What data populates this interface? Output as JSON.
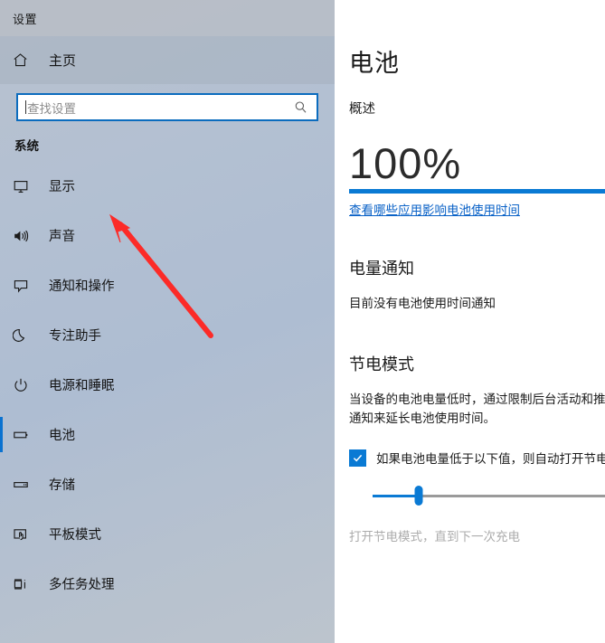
{
  "window": {
    "title": "设置"
  },
  "sidebar": {
    "home": {
      "label": "主页",
      "icon": "home-icon"
    },
    "search": {
      "placeholder": "查找设置",
      "value": "",
      "icon": "search-icon"
    },
    "section_title": "系统",
    "items": [
      {
        "label": "显示",
        "icon": "monitor-icon",
        "selected": false
      },
      {
        "label": "声音",
        "icon": "speaker-icon",
        "selected": false
      },
      {
        "label": "通知和操作",
        "icon": "notification-bubble-icon",
        "selected": false
      },
      {
        "label": "专注助手",
        "icon": "moon-icon",
        "selected": false
      },
      {
        "label": "电源和睡眠",
        "icon": "power-icon",
        "selected": false
      },
      {
        "label": "电池",
        "icon": "battery-icon",
        "selected": true
      },
      {
        "label": "存储",
        "icon": "storage-icon",
        "selected": false
      },
      {
        "label": "平板模式",
        "icon": "tablet-mode-icon",
        "selected": false
      },
      {
        "label": "多任务处理",
        "icon": "multitasking-icon",
        "selected": false
      }
    ]
  },
  "content": {
    "page_title": "电池",
    "overview_heading": "概述",
    "battery_percent": "100%",
    "battery_level": 100,
    "battery_link": "查看哪些应用影响电池使用时间",
    "notifications_heading": "电量通知",
    "notifications_text": "目前没有电池使用时间通知",
    "battery_saver_heading": "节电模式",
    "battery_saver_description": "当设备的电池电量低时，通过限制后台活动和推送通知来延长电池使用时间。",
    "checkbox_label": "如果电池电量低于以下值，则自动打开节电模式：",
    "checkbox_checked": true,
    "checkbox_glyph": "✓",
    "slider_value": 20,
    "slider_disabled_note": "打开节电模式，直到下一次充电"
  },
  "annotation": {
    "type": "arrow",
    "color": "#fc2b28",
    "points_to": "显示"
  },
  "colors": {
    "accent": "#0a7ad4",
    "link": "#0a62c7",
    "selection_bar": "#0a72d0",
    "annotation_red": "#fc2b28"
  }
}
